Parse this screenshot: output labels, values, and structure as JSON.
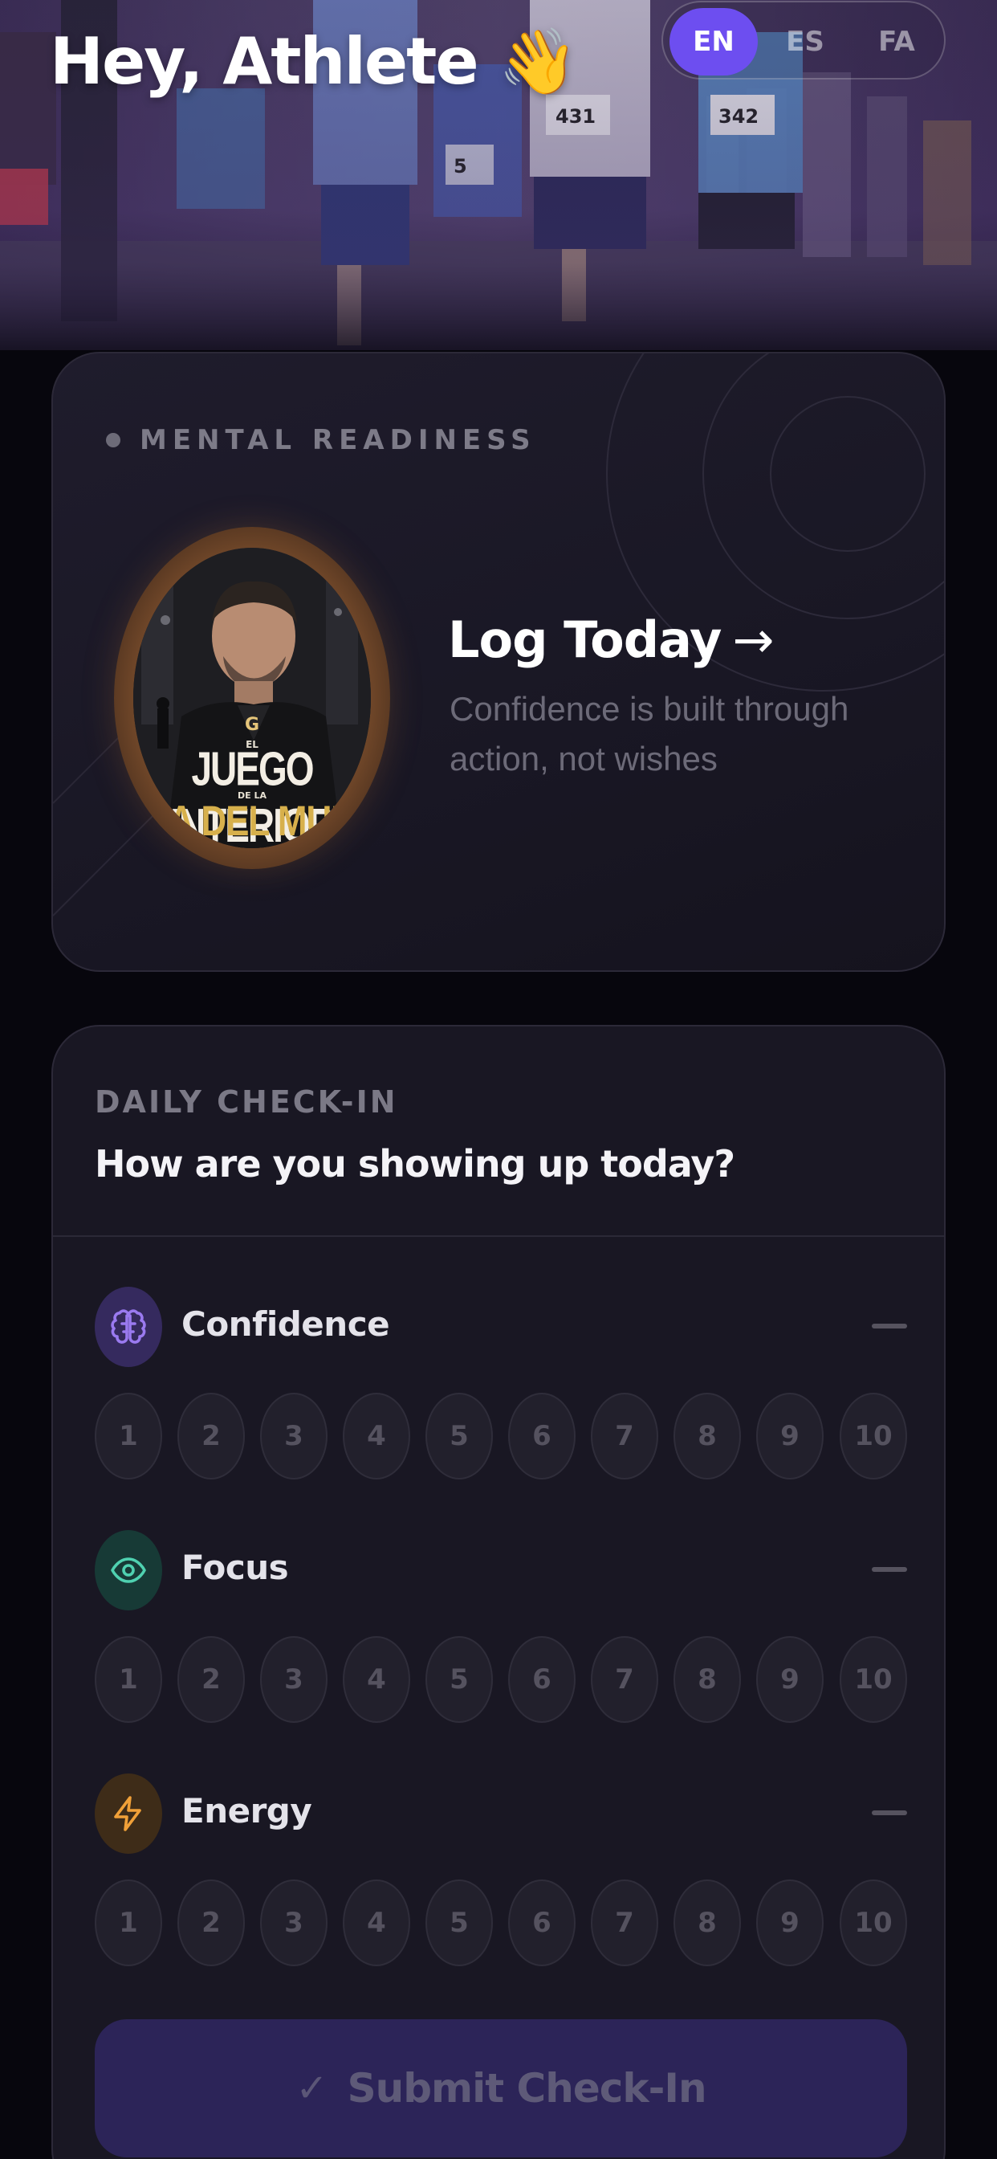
{
  "header": {
    "greeting": "Hey, Athlete 👋",
    "languages": [
      {
        "code": "EN",
        "active": true
      },
      {
        "code": "ES",
        "active": false
      },
      {
        "code": "FA",
        "active": false
      }
    ],
    "runner_bibs": [
      "431",
      "342",
      "5"
    ]
  },
  "mental_readiness": {
    "label": "MENTAL READINESS",
    "action": "Log Today",
    "arrow": "→",
    "quote": "Confidence is built through action, not wishes",
    "book": {
      "logo": "G",
      "top_word": "EL",
      "title": "JUEGO INTERIOR",
      "mid_words": "DE LA",
      "subtitle": "PA DEL MUN"
    }
  },
  "daily_checkin": {
    "label": "DAILY CHECK-IN",
    "question": "How are you showing up today?",
    "metrics": [
      {
        "name": "Confidence",
        "icon": "brain-icon",
        "color": "#9a7af0",
        "icon_bg": "#352a5e",
        "value": "—"
      },
      {
        "name": "Focus",
        "icon": "eye-icon",
        "color": "#4fd1b0",
        "icon_bg": "#173a36",
        "value": "—"
      },
      {
        "name": "Energy",
        "icon": "lightning-icon",
        "color": "#f0a038",
        "icon_bg": "#3e2c18",
        "value": "—"
      }
    ],
    "scale": [
      "1",
      "2",
      "3",
      "4",
      "5",
      "6",
      "7",
      "8",
      "9",
      "10"
    ],
    "submit_label": "Submit Check-In",
    "submit_icon": "✓"
  },
  "colors": {
    "accent": "#6d4ef0",
    "background": "#07060d",
    "card": "#191723"
  }
}
